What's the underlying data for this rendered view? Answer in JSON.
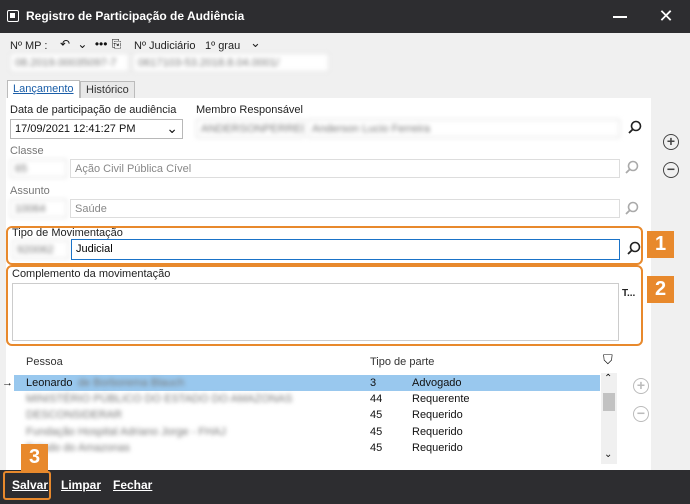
{
  "window": {
    "title": "Registro de Participação de Audiência"
  },
  "header": {
    "mp_label": "Nº MP :",
    "mp_value": "08.2019.00035097-7",
    "judiciario_label": "Nº Judiciário",
    "grau_label": "1º grau",
    "judiciario_value": "0617103-53.2018.8.04.0001/"
  },
  "tabs": [
    {
      "label": "Lançamento"
    },
    {
      "label": "Histórico"
    }
  ],
  "form": {
    "data_label": "Data de participação de audiência",
    "data_value": "17/09/2021 12:41:27 PM",
    "membro_label": "Membro Responsável",
    "membro_code": "ANDERSONPERRER",
    "membro_name": "Anderson Lucio Ferreira",
    "classe_label": "Classe",
    "classe_code": "65",
    "classe_value": "Ação Civil Pública Cível",
    "assunto_label": "Assunto",
    "assunto_code": "10064",
    "assunto_value": "Saúde",
    "tipo_label": "Tipo de Movimentação",
    "tipo_code": "920062",
    "tipo_value": "Judicial",
    "complemento_label": "Complemento da movimentação",
    "complemento_btn": "T..."
  },
  "grid": {
    "columns": [
      "Pessoa",
      "Tipo de parte"
    ],
    "rows": [
      {
        "pessoa_visible": "Leonardo",
        "pessoa_hidden": "de Borborema Blauch",
        "code": "3",
        "tipo": "Advogado"
      },
      {
        "pessoa_visible": "",
        "pessoa_hidden": "MINISTÉRIO PÚBLICO DO ESTADO DO AMAZONAS",
        "code": "44",
        "tipo": "Requerente"
      },
      {
        "pessoa_visible": "",
        "pessoa_hidden": "DESCONSIDERAR",
        "code": "45",
        "tipo": "Requerido"
      },
      {
        "pessoa_visible": "",
        "pessoa_hidden": "Fundação Hospital Adriano Jorge - FHAJ",
        "code": "45",
        "tipo": "Requerido"
      },
      {
        "pessoa_visible": "",
        "pessoa_hidden": "Estado do Amazonas",
        "code": "45",
        "tipo": "Requerido"
      }
    ]
  },
  "annotations": {
    "badge1": "1",
    "badge2": "2",
    "badge3": "3",
    "color": "#e8892c"
  },
  "footer": {
    "salvar": "Salvar",
    "limpar": "Limpar",
    "fechar": "Fechar"
  }
}
